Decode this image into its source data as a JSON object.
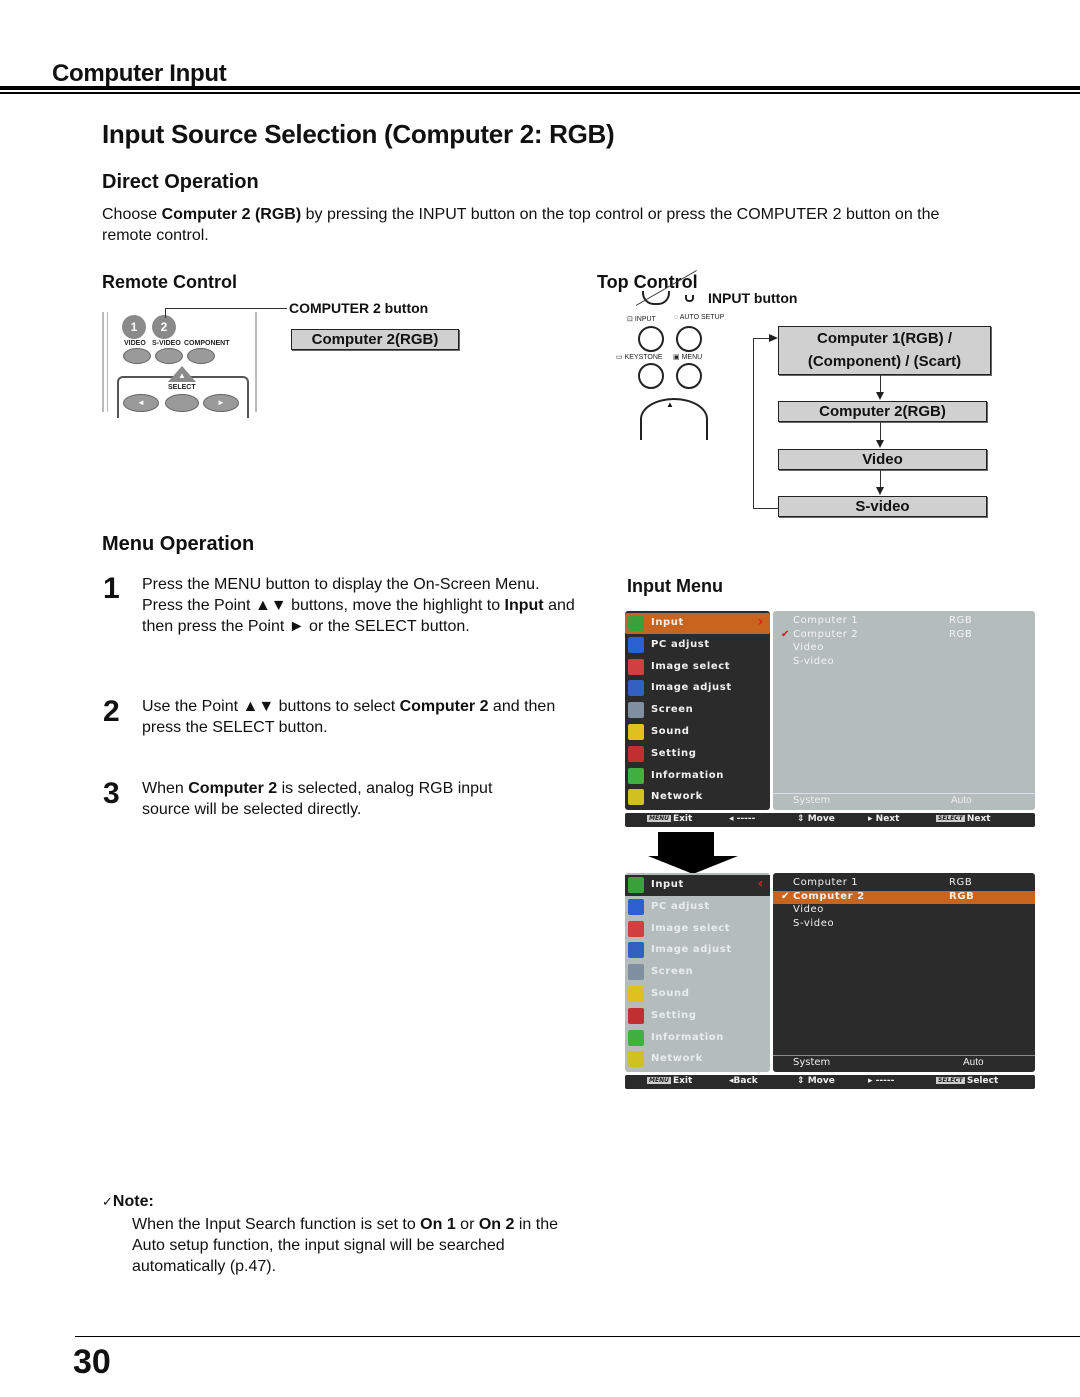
{
  "section_title": "Computer Input",
  "page_title": "Input Source Selection (Computer 2: RGB)",
  "direct_operation": {
    "heading": "Direct Operation",
    "text_pre": "Choose ",
    "text_bold": "Computer 2 (RGB)",
    "text_post": " by pressing the INPUT button on the top control or press the COMPUTER 2 button on the remote control."
  },
  "remote_control": {
    "heading": "Remote Control",
    "callout": "COMPUTER 2 button",
    "result_box": "Computer 2(RGB)",
    "buttons": {
      "num1": "1",
      "num2": "2",
      "video": "VIDEO",
      "svideo": "S-VIDEO",
      "component": "COMPONENT",
      "select": "SELECT"
    }
  },
  "top_control": {
    "heading": "Top Control",
    "callout": "INPUT button",
    "labels": {
      "input": "INPUT",
      "auto_setup": "AUTO SETUP",
      "keystone": "KEYSTONE",
      "menu": "MENU"
    },
    "flow": [
      {
        "line1": "Computer 1(RGB) /",
        "line2": "(Component) / (Scart)"
      },
      {
        "line1": "Computer 2(RGB)"
      },
      {
        "line1": "Video"
      },
      {
        "line1": "S-video"
      }
    ]
  },
  "menu_operation": {
    "heading": "Menu Operation",
    "steps": [
      {
        "num": "1",
        "parts": [
          "Press the MENU button to display the On-Screen Menu. Press the Point ▲▼ buttons, move the highlight to ",
          "Input",
          " and then press the Point ► or the SELECT button."
        ]
      },
      {
        "num": "2",
        "parts": [
          "Use the Point ▲▼ buttons to select ",
          "Computer 2",
          " and then press the SELECT button."
        ]
      },
      {
        "num": "3",
        "parts": [
          "When ",
          "Computer 2",
          " is selected, analog RGB input source will be selected directly."
        ]
      }
    ]
  },
  "input_menu": {
    "heading": "Input Menu",
    "menu_items": [
      "Input",
      "PC adjust",
      "Image select",
      "Image adjust",
      "Screen",
      "Sound",
      "Setting",
      "Information",
      "Network"
    ],
    "sub_items": [
      {
        "name": "Computer 1",
        "value": "RGB"
      },
      {
        "name": "Computer 2",
        "value": "RGB",
        "checked": true
      },
      {
        "name": "Video",
        "value": ""
      },
      {
        "name": "S-video",
        "value": ""
      }
    ],
    "system_label": "System",
    "system_value": "Auto",
    "screen1_footer": {
      "exit": "Exit",
      "back": "-----",
      "move": "Move",
      "next": "Next",
      "select": "Next",
      "menu_key": "MENU",
      "select_key": "SELECT"
    },
    "screen2_footer": {
      "exit": "Exit",
      "back": "Back",
      "move": "Move",
      "next": "-----",
      "select": "Select",
      "menu_key": "MENU",
      "select_key": "SELECT"
    },
    "colors": {
      "highlight": "#c8641e",
      "dark_panel": "#2b2b2b",
      "light_panel": "#b4bcbc"
    }
  },
  "note": {
    "label": "Note:",
    "parts": [
      "When the Input Search function is set to ",
      "On 1",
      " or ",
      "On 2",
      " in the Auto setup function, the input signal will be searched automatically (p.47)."
    ]
  },
  "page_number": "30"
}
